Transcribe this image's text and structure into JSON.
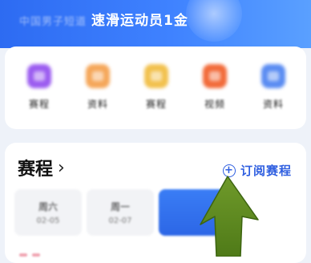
{
  "banner": {
    "subtitle": "中国男子短道",
    "title": "速滑运动员1金"
  },
  "apps": [
    {
      "label": "赛程",
      "icon": "calendar-icon",
      "color": "#9b5cf0"
    },
    {
      "label": "资料",
      "icon": "book-icon",
      "color": "#f5a75a"
    },
    {
      "label": "赛程",
      "icon": "trophy-icon",
      "color": "#f2c14e"
    },
    {
      "label": "视频",
      "icon": "video-icon",
      "color": "#f26b3a"
    },
    {
      "label": "资料",
      "icon": "chart-icon",
      "color": "#5a8cf2"
    }
  ],
  "schedule": {
    "title": "赛程",
    "chevron": "›",
    "subscribe_label": "订阅赛程",
    "days": [
      {
        "name": "周六",
        "date": "02-05"
      },
      {
        "name": "周一",
        "date": "02-07"
      },
      {
        "name": "",
        "date": ""
      }
    ]
  },
  "colors": {
    "banner": "#2d6bf2",
    "accent": "#2f5fe0",
    "arrow": "#5e8a1f"
  }
}
